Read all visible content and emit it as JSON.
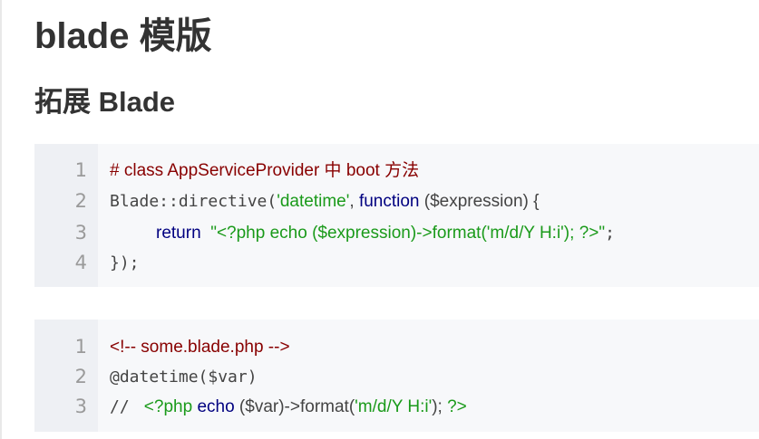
{
  "page_title": "blade 模版",
  "section_title": "拓展 Blade",
  "code_block_1": {
    "line_numbers": [
      "1",
      "2",
      "3",
      "4"
    ],
    "lines": [
      {
        "comment": "# class AppServiceProvider 中 boot 方法"
      },
      {
        "call": "Blade::directive(",
        "string": "'datetime'",
        "comma": ", ",
        "keyword": "function",
        "params": " ($expression) {"
      },
      {
        "keyword": "return",
        "string": "\"<?php echo ($expression)->format('m/d/Y H:i'); ?>\"",
        "end": ";"
      },
      {
        "close": "});"
      }
    ]
  },
  "code_block_2": {
    "line_numbers": [
      "1",
      "2",
      "3"
    ],
    "lines": [
      {
        "comment": "<!-- some.blade.php -->"
      },
      {
        "directive": "@datetime($var)"
      },
      {
        "slashes": "// ",
        "open_tag": "<?php",
        "keyword": "echo",
        "rest": " ($var)->format(",
        "string": "'m/d/Y H:i'",
        "after": "); ",
        "close_tag": "?>"
      }
    ]
  }
}
